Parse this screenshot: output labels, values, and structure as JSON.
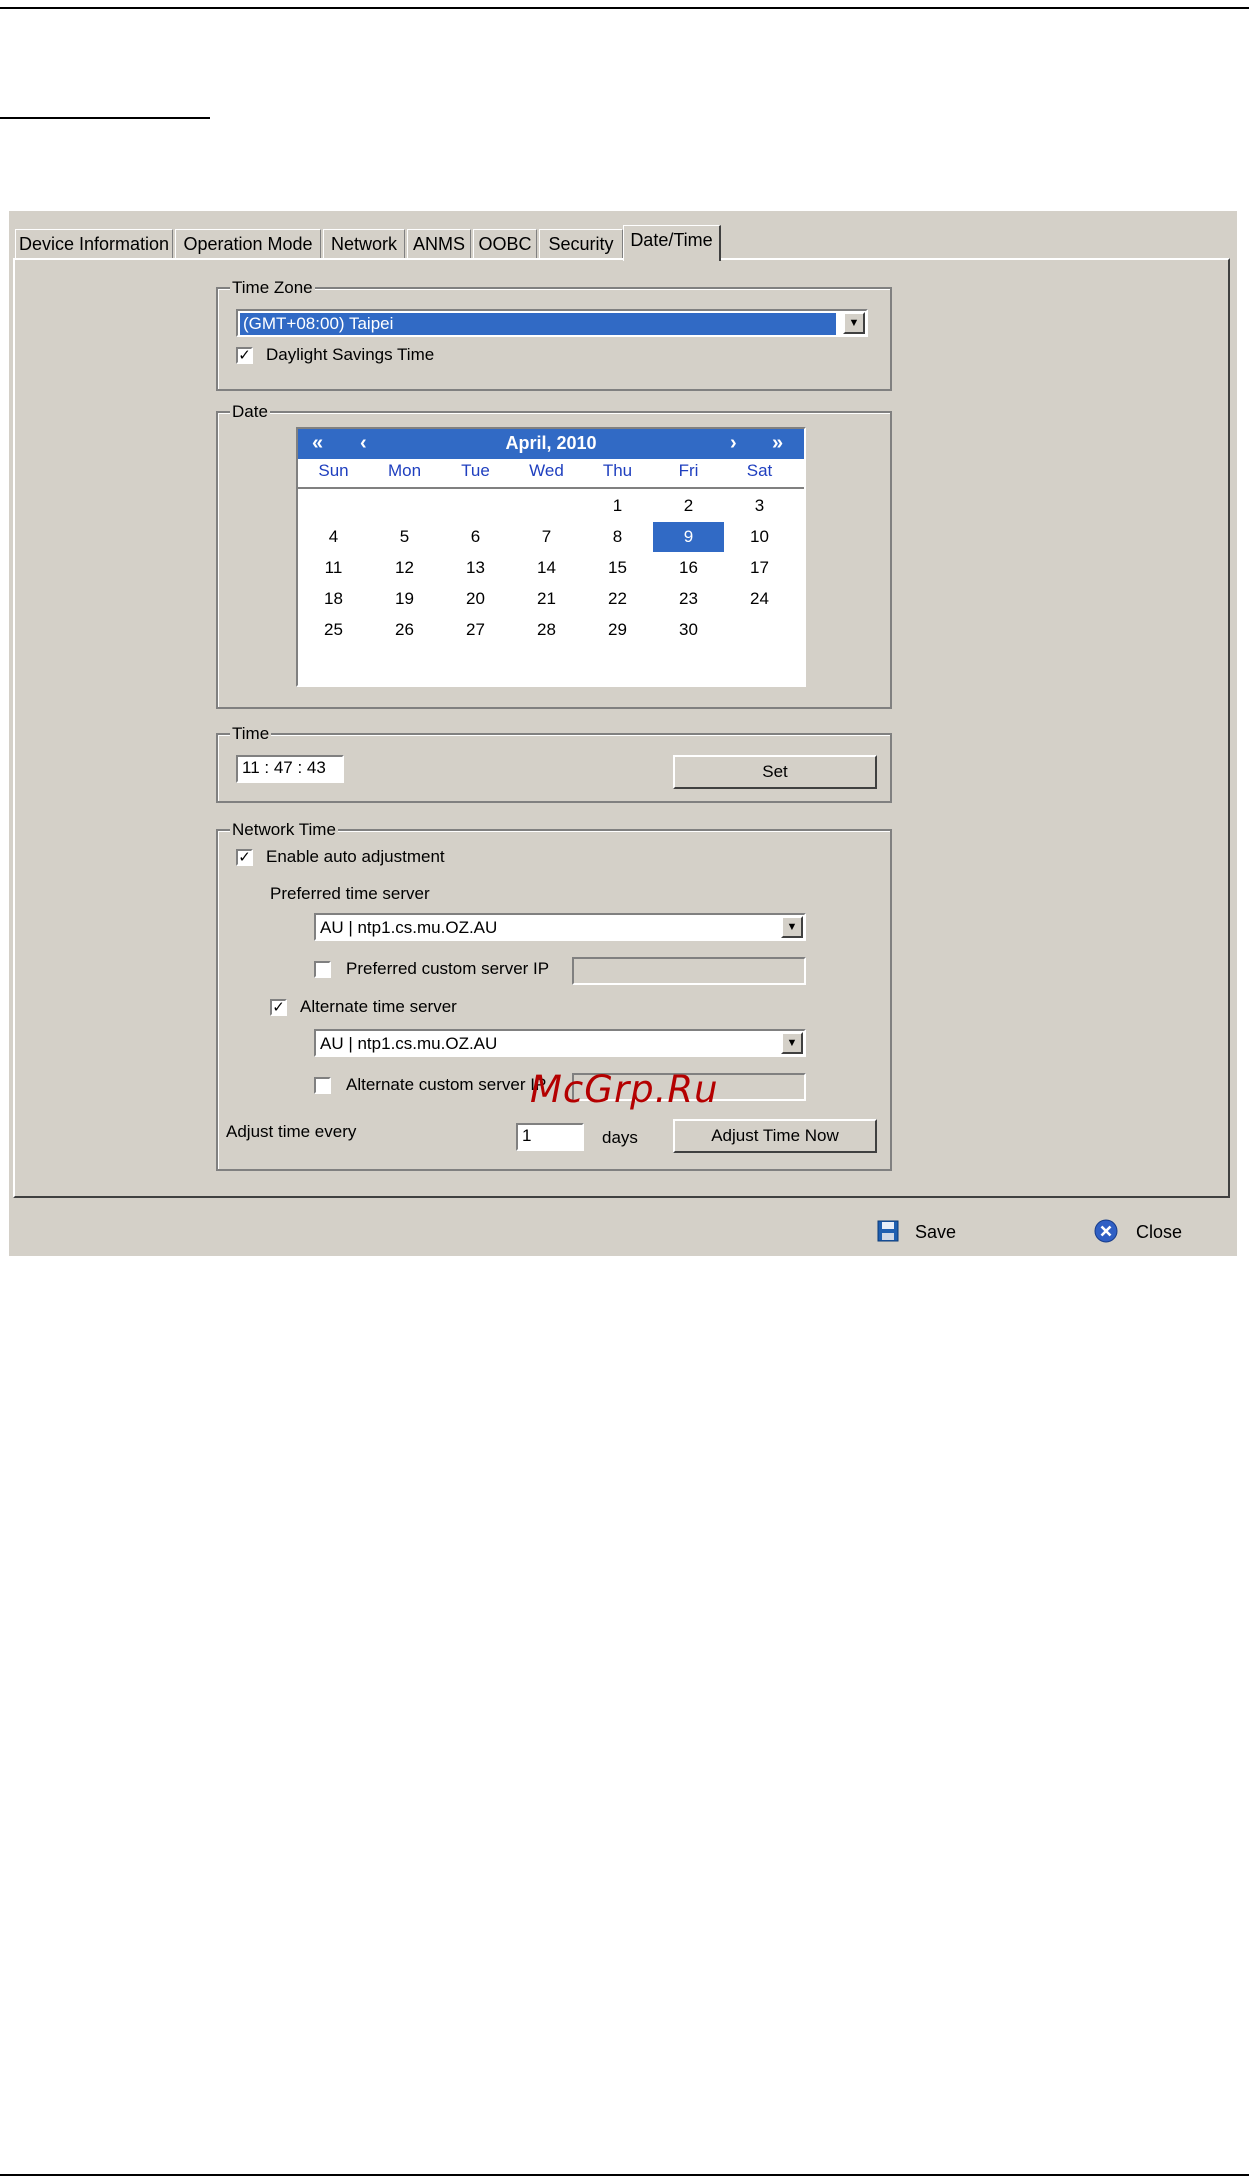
{
  "tabs": [
    "Device Information",
    "Operation Mode",
    "Network",
    "ANMS",
    "OOBC",
    "Security",
    "Date/Time"
  ],
  "active_tab": "Date/Time",
  "time_zone": {
    "legend": "Time Zone",
    "selected": "(GMT+08:00) Taipei",
    "daylight_label": "Daylight Savings Time",
    "daylight_checked": true
  },
  "date": {
    "legend": "Date",
    "month_title": "April, 2010",
    "nav": {
      "prev_year": "«",
      "prev_month": "‹",
      "next_month": "›",
      "next_year": "»"
    },
    "weekdays": [
      "Sun",
      "Mon",
      "Tue",
      "Wed",
      "Thu",
      "Fri",
      "Sat"
    ],
    "weeks": [
      [
        "",
        "",
        "",
        "",
        "1",
        "2",
        "3"
      ],
      [
        "4",
        "5",
        "6",
        "7",
        "8",
        "9",
        "10"
      ],
      [
        "11",
        "12",
        "13",
        "14",
        "15",
        "16",
        "17"
      ],
      [
        "18",
        "19",
        "20",
        "21",
        "22",
        "23",
        "24"
      ],
      [
        "25",
        "26",
        "27",
        "28",
        "29",
        "30",
        ""
      ]
    ],
    "selected_day": "9"
  },
  "time": {
    "legend": "Time",
    "value": "11 : 47 : 43",
    "set_label": "Set"
  },
  "network_time": {
    "legend": "Network Time",
    "enable_label": "Enable auto adjustment",
    "enable_checked": true,
    "preferred_label": "Preferred time server",
    "preferred_server": "AU | ntp1.cs.mu.OZ.AU",
    "preferred_custom_label": "Preferred custom server IP",
    "preferred_custom_checked": false,
    "preferred_custom_value": "",
    "alternate_label": "Alternate time server",
    "alternate_checked": true,
    "alternate_server": "AU | ntp1.cs.mu.OZ.AU",
    "alternate_custom_label": "Alternate custom server IP",
    "alternate_custom_checked": false,
    "alternate_custom_value": "",
    "adjust_every_label": "Adjust time every",
    "adjust_every_value": "1",
    "days_label": "days",
    "adjust_now_label": "Adjust Time Now"
  },
  "footer": {
    "save_label": "Save",
    "close_label": "Close"
  },
  "watermark": "McGrp.Ru",
  "colors": {
    "window_bg": "#d4d0c8",
    "selection": "#316ac5",
    "weekday_text": "#1f3fbf",
    "watermark": "#b40000"
  }
}
